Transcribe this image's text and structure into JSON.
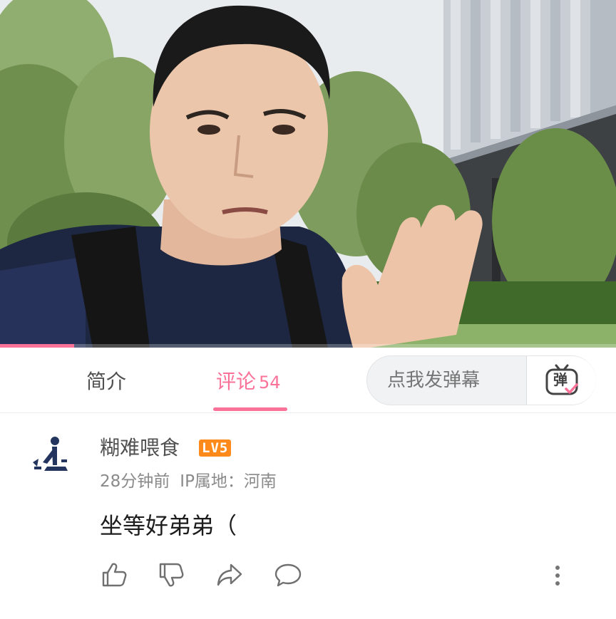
{
  "video": {
    "progress_percent": 12,
    "progress_color": "#fb7299"
  },
  "tabs": {
    "intro_label": "简介",
    "comments_label": "评论",
    "comments_count": "54",
    "active_color": "#fb7299"
  },
  "danmaku": {
    "placeholder": "点我发弹幕",
    "button_glyph": "弹",
    "button_icon": "danmaku-tv-icon"
  },
  "comment": {
    "username": "糊难喂食",
    "level_badge": "LV5",
    "level_color": "#ff8a1c",
    "time": "28分钟前",
    "ip_location": "IP属地：河南",
    "text": "坐等好弟弟（",
    "actions": [
      "like-icon",
      "dislike-icon",
      "share-icon",
      "reply-icon",
      "more-icon"
    ]
  }
}
